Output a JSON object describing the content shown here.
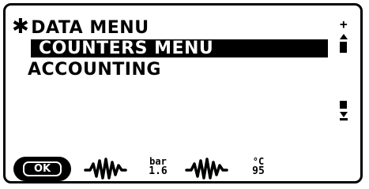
{
  "menu": {
    "title_symbol": "✱",
    "title": "DATA MENU",
    "items": [
      {
        "label": "COUNTERS MENU",
        "selected": true
      },
      {
        "label": "ACCOUNTING",
        "selected": false
      }
    ]
  },
  "scrollbar": {
    "top_symbol": "+",
    "bottom_symbol": "-"
  },
  "footer": {
    "ok_label": "OK",
    "pressure": {
      "unit": "bar",
      "value": "1.6"
    },
    "temperature": {
      "unit": "°C",
      "value": "95"
    },
    "icons": [
      "ok-button-icon",
      "waveform-icon",
      "pressure-readout",
      "waveform-icon",
      "temperature-readout"
    ]
  }
}
